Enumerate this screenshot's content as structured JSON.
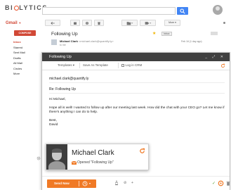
{
  "brand": {
    "logo_text": [
      "BI",
      "LYTICS"
    ]
  },
  "gmail": {
    "label": "Gmail",
    "compose_label": "COMPOSE",
    "nav": [
      "Inbox",
      "Starred",
      "Sent Mail",
      "Drafts",
      "All Mail",
      "Circles",
      "More"
    ]
  },
  "toolbar": {
    "more_label": "More"
  },
  "thread": {
    "subject": "Following Up",
    "tag": "Inbox",
    "sender_name": "Michael Clark",
    "sender_email": "<michael.clark@quantify.ly>",
    "to": "to me",
    "date": "Feb 16 (1 day ago)"
  },
  "compose": {
    "title": "Following Up",
    "templates_label": "Templates",
    "save_template_label": "Save As Template",
    "log_crm_label": "Log in CRM",
    "to": "michael.clark@quantify.ly",
    "subject": "Re: Following Up",
    "greeting": "Hi Michael,",
    "body": "Hope all is well! I wanted to follow up after our meeting last week. How did the chat with your CEO go? Let me know if there's anything I can do to help.",
    "signoff": "Best,",
    "signature": "David",
    "send_label": "Send Now"
  },
  "card": {
    "name": "Michael Clark",
    "status": "Opened \"Following Up\""
  },
  "colors": {
    "gmail_red": "#d14836",
    "accent_orange": "#f07a26",
    "search_blue": "#4285f4",
    "title_bar": "#404040"
  }
}
